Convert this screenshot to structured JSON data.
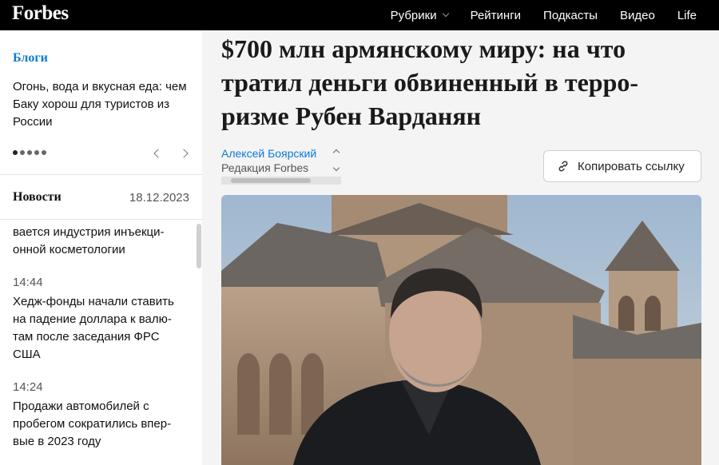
{
  "header": {
    "logo": "Forbes",
    "nav": [
      {
        "label": "Рубрики",
        "has_dropdown": true
      },
      {
        "label": "Рейтинги"
      },
      {
        "label": "Подкасты"
      },
      {
        "label": "Видео"
      },
      {
        "label": "Life"
      }
    ]
  },
  "sidebar": {
    "blogs": {
      "title": "Блоги",
      "text": "Огонь, вода и вкусная еда: чем Баку хорош для туристов из России",
      "slides_total": 5,
      "active_slide": 1
    },
    "news": {
      "title": "Новости",
      "date": "18.12.2023",
      "items": [
        {
          "time": "",
          "text": "вается индустрия инъекци-онной косметологии"
        },
        {
          "time": "14:44",
          "text": "Хедж-фонды начали ставить на падение доллара к валю-там после заседания ФРС США"
        },
        {
          "time": "14:24",
          "text": "Продажи автомобилей с пробегом сократились впер-вые в 2023 году"
        }
      ]
    }
  },
  "article": {
    "title": "$700 млн армянскому миру: на что тратил деньги обвиненный в терро-ризме Рубен Варданян",
    "author": "Алексей Боярский",
    "edition": "Редакция Forbes",
    "copy_link_label": "Копировать ссылку"
  },
  "colors": {
    "accent": "#0a7bd6",
    "topbar": "#000000"
  }
}
